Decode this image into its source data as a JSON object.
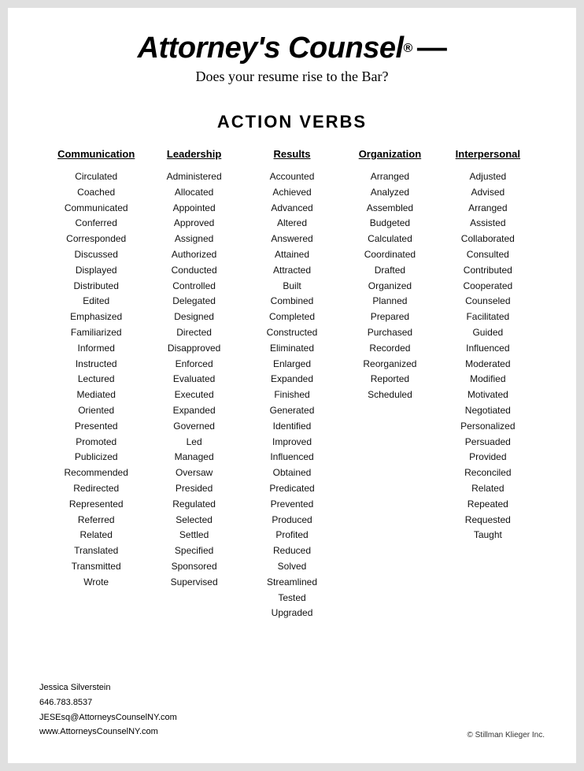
{
  "header": {
    "title": "Attorney's Counsel",
    "reg_symbol": "®",
    "dash": "—",
    "subtitle": "Does your resume rise to the Bar?"
  },
  "section_title": "ACTION VERBS",
  "columns": [
    {
      "header": "Communication",
      "words": [
        "Circulated",
        "Coached",
        "Communicated",
        "Conferred",
        "Corresponded",
        "Discussed",
        "Displayed",
        "Distributed",
        "Edited",
        "Emphasized",
        "Familiarized",
        "Informed",
        "Instructed",
        "Lectured",
        "Mediated",
        "Oriented",
        "Presented",
        "Promoted",
        "Publicized",
        "Recommended",
        "Redirected",
        "Represented",
        "Referred",
        "Related",
        "Translated",
        "Transmitted",
        "Wrote"
      ]
    },
    {
      "header": "Leadership",
      "words": [
        "Administered",
        "Allocated",
        "Appointed",
        "Approved",
        "Assigned",
        "Authorized",
        "Conducted",
        "Controlled",
        "Delegated",
        "Designed",
        "Directed",
        "Disapproved",
        "Enforced",
        "Evaluated",
        "Executed",
        "Expanded",
        "Governed",
        "Led",
        "Managed",
        "Oversaw",
        "Presided",
        "Regulated",
        "Selected",
        "Settled",
        "Specified",
        "Sponsored",
        "Supervised"
      ]
    },
    {
      "header": "Results",
      "words": [
        "Accounted",
        "Achieved",
        "Advanced",
        "Altered",
        "Answered",
        "Attained",
        "Attracted",
        "Built",
        "Combined",
        "Completed",
        "Constructed",
        "Eliminated",
        "Enlarged",
        "Expanded",
        "Finished",
        "Generated",
        "Identified",
        "Improved",
        "Influenced",
        "Obtained",
        "Predicated",
        "Prevented",
        "Produced",
        "Profited",
        "Reduced",
        "Solved",
        "Streamlined",
        "Tested",
        "Upgraded"
      ]
    },
    {
      "header": "Organization",
      "words": [
        "Arranged",
        "Analyzed",
        "Assembled",
        "Budgeted",
        "Calculated",
        "Coordinated",
        "Drafted",
        "Organized",
        "Planned",
        "Prepared",
        "Purchased",
        "Recorded",
        "Reorganized",
        "Reported",
        "Scheduled"
      ]
    },
    {
      "header": "Interpersonal",
      "words": [
        "Adjusted",
        "Advised",
        "Arranged",
        "Assisted",
        "Collaborated",
        "Consulted",
        "Contributed",
        "Cooperated",
        "Counseled",
        "Facilitated",
        "Guided",
        "Influenced",
        "Moderated",
        "Modified",
        "Motivated",
        "Negotiated",
        "Personalized",
        "Persuaded",
        "Provided",
        "Reconciled",
        "Related",
        "Repeated",
        "Requested",
        "Taught"
      ]
    }
  ],
  "footer": {
    "name": "Jessica Silverstein",
    "phone": "646.783.8537",
    "email": "JESEsq@AttorneysCounselNY.com",
    "website": "www.AttorneysCounselNY.com",
    "copyright": "© Stillman Klieger Inc."
  }
}
